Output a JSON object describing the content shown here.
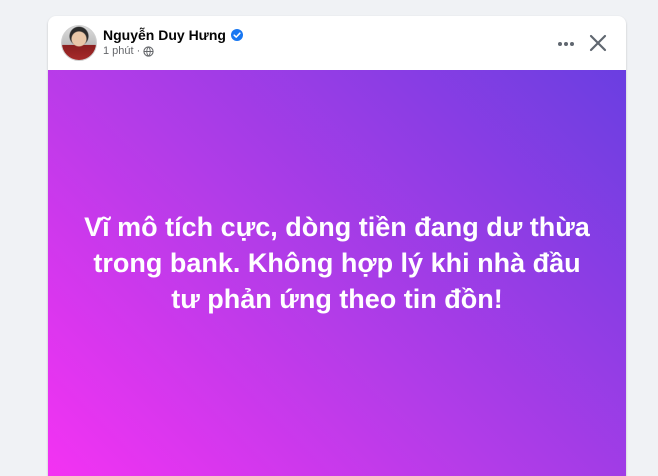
{
  "post": {
    "author_name": "Nguyễn Duy Hưng",
    "timestamp": "1 phút",
    "audience_icon": "globe-icon",
    "verified_icon": "verified-badge-icon",
    "body_text": "Vĩ mô tích cực, dòng tiền đang dư thừa trong bank. Không hợp lý khi nhà đầu tư phản ứng theo tin đồn!",
    "background_gradient": [
      "#f532f3",
      "#b43ce8",
      "#6a3ee1"
    ],
    "text_color": "#ffffff"
  },
  "actions": {
    "more_icon": "more-horizontal-icon",
    "close_icon": "close-icon"
  }
}
